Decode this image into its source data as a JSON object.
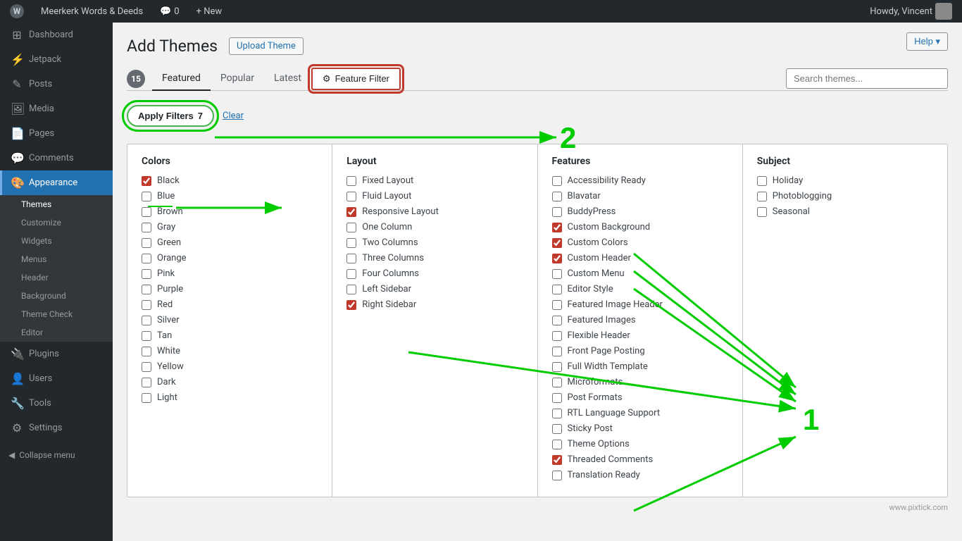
{
  "adminbar": {
    "site_name": "Meerkerk Words & Deeds",
    "comments_count": "0",
    "new_label": "+ New",
    "howdy": "Howdy, Vincent",
    "help_label": "Help ▾"
  },
  "sidebar": {
    "items": [
      {
        "id": "dashboard",
        "label": "Dashboard",
        "icon": "⊞"
      },
      {
        "id": "jetpack",
        "label": "Jetpack",
        "icon": "⚡"
      },
      {
        "id": "posts",
        "label": "Posts",
        "icon": "✎"
      },
      {
        "id": "media",
        "label": "Media",
        "icon": "🖼"
      },
      {
        "id": "pages",
        "label": "Pages",
        "icon": "📄"
      },
      {
        "id": "comments",
        "label": "Comments",
        "icon": "💬"
      },
      {
        "id": "appearance",
        "label": "Appearance",
        "icon": "🎨",
        "active": true
      }
    ],
    "appearance_subitems": [
      {
        "id": "themes",
        "label": "Themes",
        "active": true
      },
      {
        "id": "customize",
        "label": "Customize"
      },
      {
        "id": "widgets",
        "label": "Widgets"
      },
      {
        "id": "menus",
        "label": "Menus"
      },
      {
        "id": "header",
        "label": "Header"
      },
      {
        "id": "background",
        "label": "Background"
      },
      {
        "id": "theme_check",
        "label": "Theme Check"
      },
      {
        "id": "editor",
        "label": "Editor"
      }
    ],
    "bottom_items": [
      {
        "id": "plugins",
        "label": "Plugins",
        "icon": "🔌"
      },
      {
        "id": "users",
        "label": "Users",
        "icon": "👤"
      },
      {
        "id": "tools",
        "label": "Tools",
        "icon": "🔧"
      },
      {
        "id": "settings",
        "label": "Settings",
        "icon": "⚙"
      }
    ],
    "collapse_label": "Collapse menu"
  },
  "page": {
    "title": "Add Themes",
    "upload_label": "Upload Theme",
    "help_label": "Help ▾"
  },
  "tabs": {
    "count": "15",
    "items": [
      {
        "id": "featured",
        "label": "Featured",
        "active": true
      },
      {
        "id": "popular",
        "label": "Popular"
      },
      {
        "id": "latest",
        "label": "Latest"
      },
      {
        "id": "feature_filter",
        "label": "⚙ Feature Filter",
        "highlighted": true
      }
    ],
    "search_placeholder": "Search themes..."
  },
  "filters_bar": {
    "apply_label": "Apply Filters",
    "count": "7",
    "clear_label": "Clear"
  },
  "colors": {
    "title": "Colors",
    "options": [
      {
        "id": "black",
        "label": "Black",
        "checked": true
      },
      {
        "id": "blue",
        "label": "Blue",
        "checked": false
      },
      {
        "id": "brown",
        "label": "Brown",
        "checked": false
      },
      {
        "id": "gray",
        "label": "Gray",
        "checked": false
      },
      {
        "id": "green",
        "label": "Green",
        "checked": false
      },
      {
        "id": "orange",
        "label": "Orange",
        "checked": false
      },
      {
        "id": "pink",
        "label": "Pink",
        "checked": false
      },
      {
        "id": "purple",
        "label": "Purple",
        "checked": false
      },
      {
        "id": "red",
        "label": "Red",
        "checked": false
      },
      {
        "id": "silver",
        "label": "Silver",
        "checked": false
      },
      {
        "id": "tan",
        "label": "Tan",
        "checked": false
      },
      {
        "id": "white",
        "label": "White",
        "checked": false
      },
      {
        "id": "yellow",
        "label": "Yellow",
        "checked": false
      },
      {
        "id": "dark",
        "label": "Dark",
        "checked": false
      },
      {
        "id": "light",
        "label": "Light",
        "checked": false
      }
    ]
  },
  "layout": {
    "title": "Layout",
    "options": [
      {
        "id": "fixed_layout",
        "label": "Fixed Layout",
        "checked": false
      },
      {
        "id": "fluid_layout",
        "label": "Fluid Layout",
        "checked": false
      },
      {
        "id": "responsive_layout",
        "label": "Responsive Layout",
        "checked": true
      },
      {
        "id": "one_column",
        "label": "One Column",
        "checked": false
      },
      {
        "id": "two_columns",
        "label": "Two Columns",
        "checked": false
      },
      {
        "id": "three_columns",
        "label": "Three Columns",
        "checked": false
      },
      {
        "id": "four_columns",
        "label": "Four Columns",
        "checked": false
      },
      {
        "id": "left_sidebar",
        "label": "Left Sidebar",
        "checked": false
      },
      {
        "id": "right_sidebar",
        "label": "Right Sidebar",
        "checked": true
      }
    ]
  },
  "features": {
    "title": "Features",
    "options": [
      {
        "id": "accessibility_ready",
        "label": "Accessibility Ready",
        "checked": false
      },
      {
        "id": "blavatar",
        "label": "Blavatar",
        "checked": false
      },
      {
        "id": "buddypress",
        "label": "BuddyPress",
        "checked": false
      },
      {
        "id": "custom_background",
        "label": "Custom Background",
        "checked": true
      },
      {
        "id": "custom_colors",
        "label": "Custom Colors",
        "checked": true
      },
      {
        "id": "custom_header",
        "label": "Custom Header",
        "checked": true
      },
      {
        "id": "custom_menu",
        "label": "Custom Menu",
        "checked": false
      },
      {
        "id": "editor_style",
        "label": "Editor Style",
        "checked": false
      },
      {
        "id": "featured_image_header",
        "label": "Featured Image Header",
        "checked": false
      },
      {
        "id": "featured_images",
        "label": "Featured Images",
        "checked": false
      },
      {
        "id": "flexible_header",
        "label": "Flexible Header",
        "checked": false
      },
      {
        "id": "front_page_posting",
        "label": "Front Page Posting",
        "checked": false
      },
      {
        "id": "full_width_template",
        "label": "Full Width Template",
        "checked": false
      },
      {
        "id": "microformats",
        "label": "Microformats",
        "checked": false
      },
      {
        "id": "post_formats",
        "label": "Post Formats",
        "checked": false
      },
      {
        "id": "rtl_language_support",
        "label": "RTL Language Support",
        "checked": false
      },
      {
        "id": "sticky_post",
        "label": "Sticky Post",
        "checked": false
      },
      {
        "id": "theme_options",
        "label": "Theme Options",
        "checked": false
      },
      {
        "id": "threaded_comments",
        "label": "Threaded Comments",
        "checked": true
      },
      {
        "id": "translation_ready",
        "label": "Translation Ready",
        "checked": false
      }
    ]
  },
  "subject": {
    "title": "Subject",
    "options": [
      {
        "id": "holiday",
        "label": "Holiday",
        "checked": false
      },
      {
        "id": "photoblogging",
        "label": "Photoblogging",
        "checked": false
      },
      {
        "id": "seasonal",
        "label": "Seasonal",
        "checked": false
      }
    ]
  },
  "annotations": {
    "num1": "1",
    "num2": "2"
  },
  "footer": {
    "credit": "www.pixtick.com"
  }
}
